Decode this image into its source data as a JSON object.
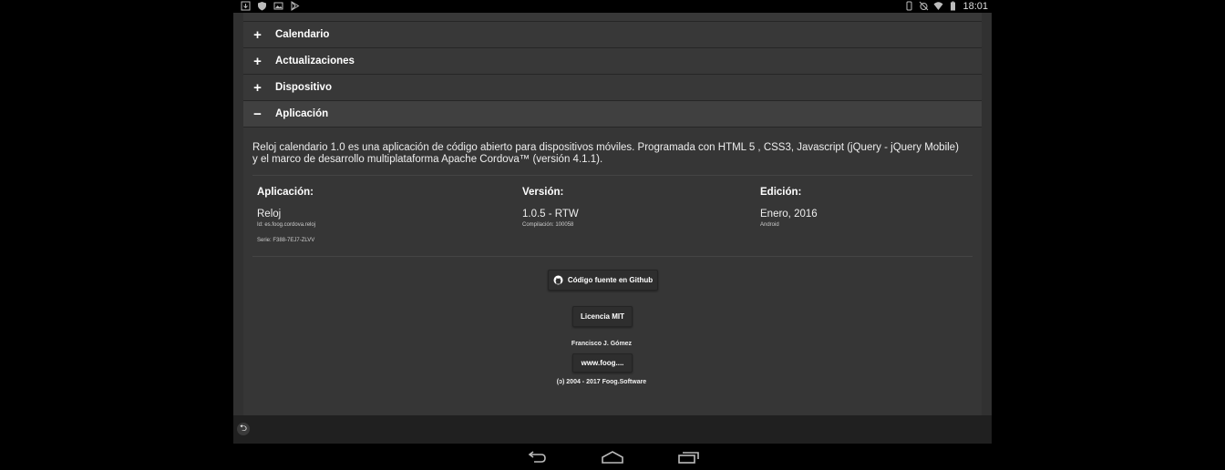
{
  "status_bar": {
    "time": "18:01",
    "left_icons": [
      "download-icon",
      "shield-icon",
      "image-icon",
      "play-store-icon"
    ],
    "right_icons": [
      "vibrate-icon",
      "no-alarm-icon",
      "wifi-icon",
      "battery-icon"
    ]
  },
  "accordion": {
    "items": [
      {
        "label": "Calendario",
        "sign": "+"
      },
      {
        "label": "Actualizaciones",
        "sign": "+"
      },
      {
        "label": "Dispositivo",
        "sign": "+"
      },
      {
        "label": "Aplicación",
        "sign": "−"
      }
    ]
  },
  "app_section": {
    "description": "Reloj calendario 1.0 es una aplicación de código abierto para dispositivos móviles. Programada con HTML 5 , CSS3, Javascript (jQuery - jQuery Mobile)  y el marco de desarrollo multiplataforma Apache Cordova™ (versión 4.1.1).",
    "app": {
      "heading": "Aplicación:",
      "value": "Reloj",
      "id": "Id: es.foog.cordova.reloj",
      "serial": "Serie: F388-7EJ7-ZLVV"
    },
    "version": {
      "heading": "Versión:",
      "value": "1.0.5 - RTW",
      "build": "Compilación: 100058"
    },
    "edition": {
      "heading": "Edición:",
      "value": "Enero, 2016",
      "platform": "Android"
    },
    "github_label": "Código fuente en Github",
    "license_label": "Licencia MIT",
    "author": "Francisco J. Gómez",
    "website_label": "www.foog....",
    "copyright": "(ɔ) 2004 - 2017 Foog.Software"
  },
  "colors": {
    "background": "#313131",
    "header": "#383838",
    "body": "#363636",
    "footer": "#202020"
  }
}
